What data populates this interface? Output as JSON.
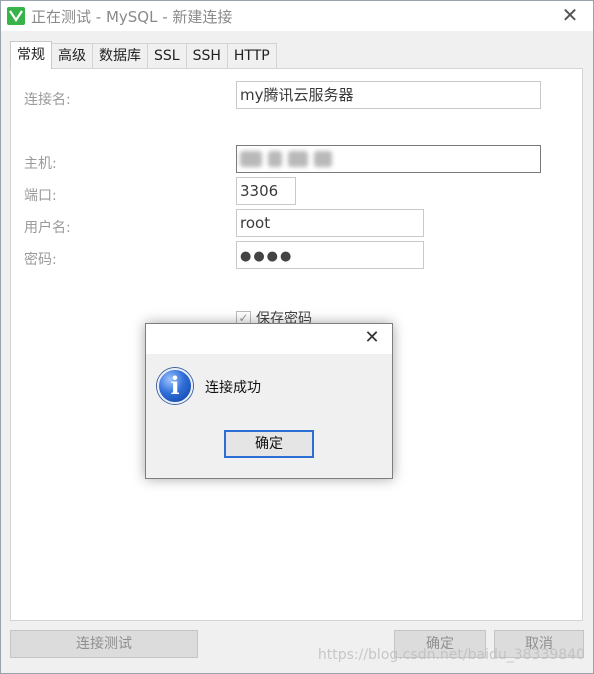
{
  "window": {
    "title": "正在测试 - MySQL - 新建连接",
    "close_glyph": "✕"
  },
  "tabs": [
    {
      "label": "常规",
      "active": true
    },
    {
      "label": "高级",
      "active": false
    },
    {
      "label": "数据库",
      "active": false
    },
    {
      "label": "SSL",
      "active": false
    },
    {
      "label": "SSH",
      "active": false
    },
    {
      "label": "HTTP",
      "active": false
    }
  ],
  "form": {
    "connection_name_label": "连接名:",
    "connection_name_value": "my腾讯云服务器",
    "host_label": "主机:",
    "port_label": "端口:",
    "port_value": "3306",
    "user_label": "用户名:",
    "user_value": "root",
    "password_label": "密码:",
    "password_value": "●●●●",
    "save_password_label": "保存密码",
    "save_password_checked": true
  },
  "buttons": {
    "test_connection": "连接测试",
    "ok": "确定",
    "cancel": "取消"
  },
  "watermark": "https://blog.csdn.net/baidu_38339840",
  "dialog": {
    "message": "连接成功",
    "ok_label": "确定",
    "icon": "info-icon"
  }
}
